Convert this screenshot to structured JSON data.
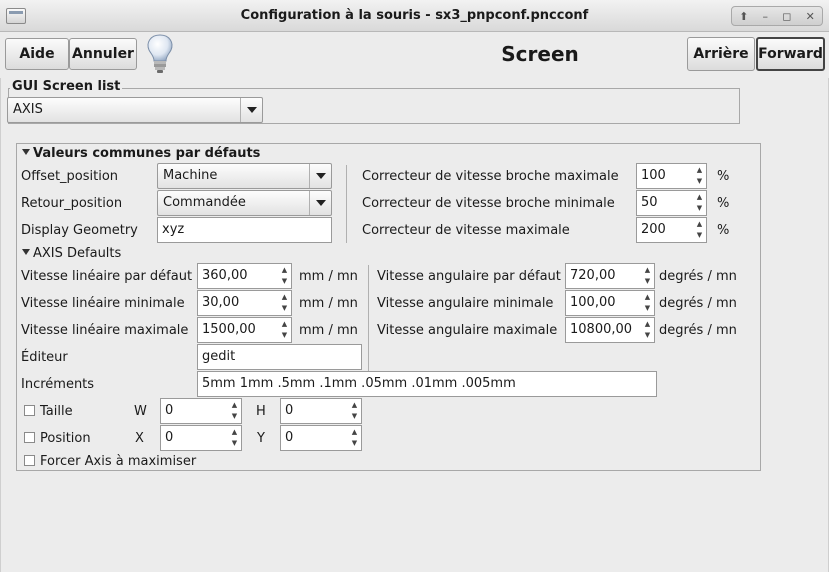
{
  "window": {
    "title": "Configuration à la souris - sx3_pnpconf.pncconf",
    "controls": [
      "⬆",
      "–",
      "◻",
      "✕"
    ]
  },
  "toolbar": {
    "help_label": "Aide",
    "cancel_label": "Annuler",
    "page_title": "Screen",
    "back_label": "Arrière",
    "forward_label": "Forward",
    "hint_icon": "lightbulb-icon"
  },
  "gui_screen": {
    "frame_label": "GUI Screen list",
    "selected": "AXIS"
  },
  "common": {
    "header": "Valeurs communes par défauts",
    "offset_label": "Offset_position",
    "offset_value": "Machine",
    "retour_label": "Retour_position",
    "retour_value": "Commandée",
    "display_label": "Display Geometry",
    "display_value": "xyz",
    "spindle_max_label": "Correcteur de vitesse broche maximale",
    "spindle_max_value": "100",
    "spindle_min_label": "Correcteur de vitesse broche minimale",
    "spindle_min_value": "50",
    "feed_max_label": "Correcteur de vitesse maximale",
    "feed_max_value": "200",
    "percent": "%"
  },
  "axis_defaults": {
    "header": "AXIS Defaults",
    "lin_default_label": "Vitesse linéaire par défaut",
    "lin_default_value": "360,00",
    "lin_min_label": "Vitesse linéaire minimale",
    "lin_min_value": "30,00",
    "lin_max_label": "Vitesse linéaire maximale",
    "lin_max_value": "1500,00",
    "lin_unit": "mm / mn",
    "ang_default_label": "Vitesse angulaire par défaut",
    "ang_default_value": "720,00",
    "ang_min_label": "Vitesse angulaire minimale",
    "ang_min_value": "100,00",
    "ang_max_label": "Vitesse angulaire maximale",
    "ang_max_value": "10800,00",
    "ang_unit": "degrés / mn",
    "editor_label": "Éditeur",
    "editor_value": "gedit",
    "increments_label": "Incréments",
    "increments_value": "5mm 1mm .5mm .1mm .05mm .01mm .005mm",
    "size_label": "Taille",
    "w_label": "W",
    "w_value": "0",
    "h_label": "H",
    "h_value": "0",
    "position_label": "Position",
    "x_label": "X",
    "x_value": "0",
    "y_label": "Y",
    "y_value": "0",
    "maximize_label": "Forcer Axis à maximiser"
  }
}
